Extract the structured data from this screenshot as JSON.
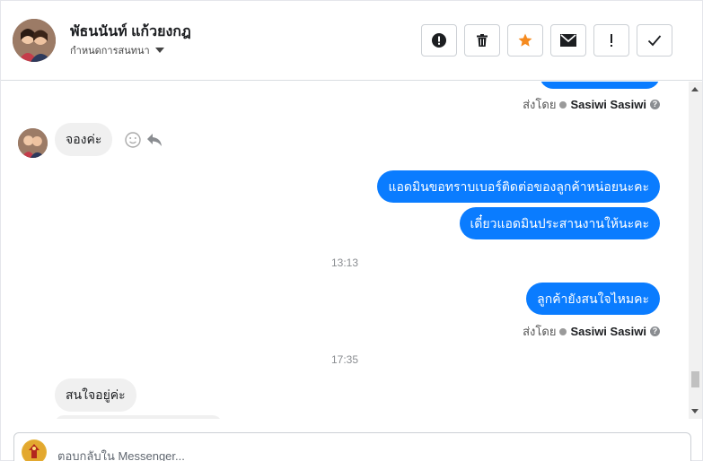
{
  "header": {
    "contact_name": "พัธนนันท์ แก้วยงกฎ",
    "subtitle": "กำหนดการสนทนา",
    "tools": [
      {
        "name": "spam",
        "icon": "exclamation-circle-icon"
      },
      {
        "name": "delete",
        "icon": "trash-icon"
      },
      {
        "name": "star",
        "icon": "star-icon",
        "color": "#f58a1f"
      },
      {
        "name": "mark-unread",
        "icon": "envelope-icon"
      },
      {
        "name": "follow-up",
        "icon": "exclamation-icon"
      },
      {
        "name": "done",
        "icon": "check-icon"
      }
    ]
  },
  "messages": {
    "sent_by_1": {
      "label": "ส่งโดย",
      "agent": "Sasiwi Sasiwi"
    },
    "incoming_1": "จองค่ะ",
    "outgoing_1": "แอดมินขอทราบเบอร์ติดต่อของลูกค้าหน่อยนะคะ",
    "outgoing_2": "เดี๋ยวแอดมินประสานงานให้นะคะ",
    "time_1": "13:13",
    "outgoing_3": "ลูกค้ายังสนใจไหมคะ",
    "sent_by_2": {
      "label": "ส่งโดย",
      "agent": "Sasiwi Sasiwi"
    },
    "time_2": "17:35",
    "incoming_2": "สนใจอยู่ค่ะ"
  },
  "composer": {
    "placeholder": "ตอบกลับใน Messenger..."
  },
  "colors": {
    "outgoing_bubble": "#0a7cff",
    "incoming_bubble": "#f0f0f0",
    "star": "#f58a1f"
  }
}
